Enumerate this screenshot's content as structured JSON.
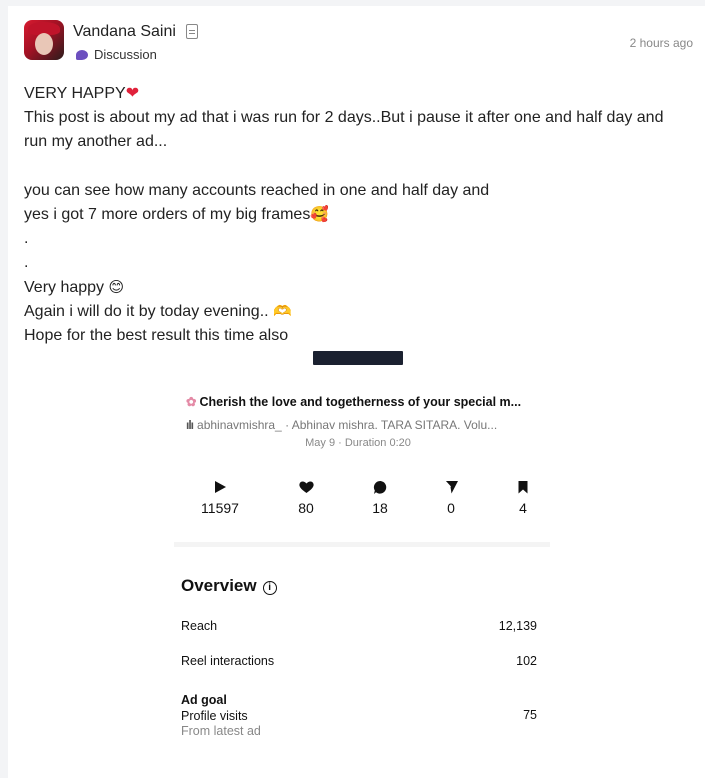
{
  "post": {
    "author": "Vandana Saini",
    "category": "Discussion",
    "time": "2 hours ago",
    "lines": [
      "VERY HAPPY",
      "This post is about my ad that i was run for 2 days..But i pause it after one and half day and",
      "run my another ad...",
      "",
      "you can see how many accounts reached in one and half day and",
      "yes i got 7 more orders of my big frames",
      ".",
      ".",
      "Very happy",
      "Again i will do it by today evening..",
      "Hope for the best result this time also"
    ],
    "icons": {
      "heart": "red-heart-emoji",
      "smiling_hearts": "smiling-face-with-hearts-emoji",
      "smile": "smiling-face-emoji",
      "heart_hands": "heart-hands-emoji"
    }
  },
  "insights": {
    "reel_title": "Cherish the love and togetherness of your special m...",
    "reel_sub": "abhinavmishra_ · Abhinav mishra. TARA SITARA. Volu...",
    "reel_date": "May 9 · Duration 0:20",
    "stats": [
      {
        "icon": "play-icon",
        "value": "11597"
      },
      {
        "icon": "heart-icon",
        "value": "80"
      },
      {
        "icon": "comment-icon",
        "value": "18"
      },
      {
        "icon": "send-icon",
        "value": "0"
      },
      {
        "icon": "bookmark-icon",
        "value": "4"
      }
    ],
    "overview": {
      "title": "Overview",
      "reach_label": "Reach",
      "reach_value": "12,139",
      "interactions_label": "Reel interactions",
      "interactions_value": "102",
      "ad_goal_label": "Ad goal",
      "ad_goal_type": "Profile visits",
      "ad_goal_note": "From latest ad",
      "ad_goal_value": "75"
    }
  },
  "colors": {
    "background": "#f3f4f6",
    "card": "#ffffff",
    "accent_purple": "#6c4fbf",
    "heart_red": "#e0223b"
  }
}
